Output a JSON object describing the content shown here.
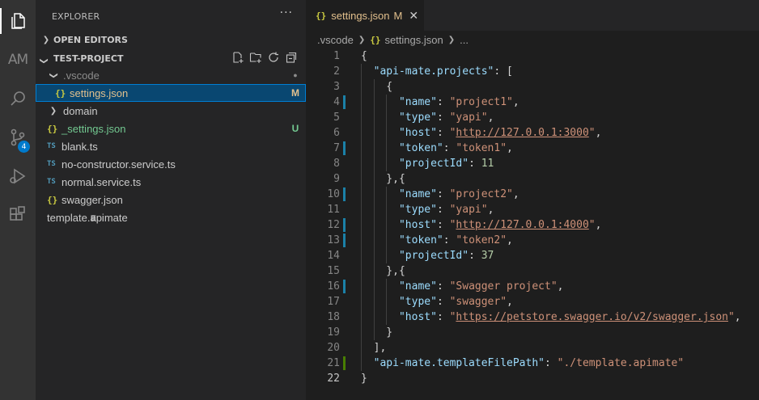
{
  "activity_bar": [
    {
      "name": "explorer-icon",
      "active": true
    },
    {
      "name": "api-mate-icon",
      "label": "AM"
    },
    {
      "name": "search-icon"
    },
    {
      "name": "source-control-icon",
      "badge": "4"
    },
    {
      "name": "run-debug-icon"
    },
    {
      "name": "extensions-icon"
    }
  ],
  "sidebar": {
    "title": "EXPLORER",
    "more": "···",
    "open_editors": "OPEN EDITORS",
    "project": "TEST-PROJECT",
    "tree": [
      {
        "label": ".vscode",
        "type": "folder",
        "expanded": true,
        "indent": 0,
        "color": "#8c8c8c",
        "deco": "●",
        "deco_color": "#8c8c8c"
      },
      {
        "label": "settings.json",
        "type": "json",
        "icon": "{}",
        "indent": 1,
        "color": "#e2c08d",
        "deco": "M",
        "deco_color": "#e2c08d",
        "selected": true
      },
      {
        "label": "domain",
        "type": "folder",
        "expanded": false,
        "indent": 0,
        "color": "#cccccc"
      },
      {
        "label": "_settings.json",
        "type": "json",
        "icon": "{}",
        "indent": 0,
        "color": "#73c991",
        "deco": "U",
        "deco_color": "#73c991"
      },
      {
        "label": "blank.ts",
        "type": "ts",
        "icon": "TS",
        "indent": 0,
        "color": "#cccccc"
      },
      {
        "label": "no-constructor.service.ts",
        "type": "ts",
        "icon": "TS",
        "indent": 0,
        "color": "#cccccc"
      },
      {
        "label": "normal.service.ts",
        "type": "ts",
        "icon": "TS",
        "indent": 0,
        "color": "#cccccc"
      },
      {
        "label": "swagger.json",
        "type": "json",
        "icon": "{}",
        "indent": 0,
        "color": "#cccccc"
      },
      {
        "label": "template.apimate",
        "type": "txt",
        "icon": "≡",
        "indent": 0,
        "color": "#cccccc"
      }
    ]
  },
  "editor": {
    "tab": {
      "icon": "{}",
      "label": "settings.json",
      "modified": "M",
      "close": "✕"
    },
    "breadcrumb": {
      "folder": ".vscode",
      "icon": "{}",
      "file": "settings.json",
      "tail": "..."
    },
    "lines": [
      {
        "n": "1",
        "gutter": "",
        "tokens": [
          [
            "{",
            "punc"
          ]
        ]
      },
      {
        "n": "2",
        "gutter": "",
        "tokens": [
          [
            "  ",
            "punc"
          ],
          [
            "\"api-mate.projects\"",
            "key"
          ],
          [
            ": [",
            "punc"
          ]
        ]
      },
      {
        "n": "3",
        "gutter": "",
        "tokens": [
          [
            "    {",
            "punc"
          ]
        ]
      },
      {
        "n": "4",
        "gutter": "mod",
        "tokens": [
          [
            "      ",
            "punc"
          ],
          [
            "\"name\"",
            "key"
          ],
          [
            ": ",
            "punc"
          ],
          [
            "\"project1\"",
            "str"
          ],
          [
            ",",
            "punc"
          ]
        ]
      },
      {
        "n": "5",
        "gutter": "",
        "tokens": [
          [
            "      ",
            "punc"
          ],
          [
            "\"type\"",
            "key"
          ],
          [
            ": ",
            "punc"
          ],
          [
            "\"yapi\"",
            "str"
          ],
          [
            ",",
            "punc"
          ]
        ]
      },
      {
        "n": "6",
        "gutter": "",
        "tokens": [
          [
            "      ",
            "punc"
          ],
          [
            "\"host\"",
            "key"
          ],
          [
            ": ",
            "punc"
          ],
          [
            "\"",
            "str"
          ],
          [
            "http://127.0.0.1:3000",
            "link"
          ],
          [
            "\"",
            "str"
          ],
          [
            ",",
            "punc"
          ]
        ]
      },
      {
        "n": "7",
        "gutter": "mod",
        "tokens": [
          [
            "      ",
            "punc"
          ],
          [
            "\"token\"",
            "key"
          ],
          [
            ": ",
            "punc"
          ],
          [
            "\"token1\"",
            "str"
          ],
          [
            ",",
            "punc"
          ]
        ]
      },
      {
        "n": "8",
        "gutter": "",
        "tokens": [
          [
            "      ",
            "punc"
          ],
          [
            "\"projectId\"",
            "key"
          ],
          [
            ": ",
            "punc"
          ],
          [
            "11",
            "num"
          ]
        ]
      },
      {
        "n": "9",
        "gutter": "",
        "tokens": [
          [
            "    },{",
            "punc"
          ]
        ]
      },
      {
        "n": "10",
        "gutter": "mod",
        "tokens": [
          [
            "      ",
            "punc"
          ],
          [
            "\"name\"",
            "key"
          ],
          [
            ": ",
            "punc"
          ],
          [
            "\"project2\"",
            "str"
          ],
          [
            ",",
            "punc"
          ]
        ]
      },
      {
        "n": "11",
        "gutter": "",
        "tokens": [
          [
            "      ",
            "punc"
          ],
          [
            "\"type\"",
            "key"
          ],
          [
            ": ",
            "punc"
          ],
          [
            "\"yapi\"",
            "str"
          ],
          [
            ",",
            "punc"
          ]
        ]
      },
      {
        "n": "12",
        "gutter": "mod",
        "tokens": [
          [
            "      ",
            "punc"
          ],
          [
            "\"host\"",
            "key"
          ],
          [
            ": ",
            "punc"
          ],
          [
            "\"",
            "str"
          ],
          [
            "http://127.0.0.1:4000",
            "link"
          ],
          [
            "\"",
            "str"
          ],
          [
            ",",
            "punc"
          ]
        ]
      },
      {
        "n": "13",
        "gutter": "mod",
        "tokens": [
          [
            "      ",
            "punc"
          ],
          [
            "\"token\"",
            "key"
          ],
          [
            ": ",
            "punc"
          ],
          [
            "\"token2\"",
            "str"
          ],
          [
            ",",
            "punc"
          ]
        ]
      },
      {
        "n": "14",
        "gutter": "",
        "tokens": [
          [
            "      ",
            "punc"
          ],
          [
            "\"projectId\"",
            "key"
          ],
          [
            ": ",
            "punc"
          ],
          [
            "37",
            "num"
          ]
        ]
      },
      {
        "n": "15",
        "gutter": "",
        "tokens": [
          [
            "    },{",
            "punc"
          ]
        ]
      },
      {
        "n": "16",
        "gutter": "mod",
        "tokens": [
          [
            "      ",
            "punc"
          ],
          [
            "\"name\"",
            "key"
          ],
          [
            ": ",
            "punc"
          ],
          [
            "\"Swagger project\"",
            "str"
          ],
          [
            ",",
            "punc"
          ]
        ]
      },
      {
        "n": "17",
        "gutter": "",
        "tokens": [
          [
            "      ",
            "punc"
          ],
          [
            "\"type\"",
            "key"
          ],
          [
            ": ",
            "punc"
          ],
          [
            "\"swagger\"",
            "str"
          ],
          [
            ",",
            "punc"
          ]
        ]
      },
      {
        "n": "18",
        "gutter": "",
        "tokens": [
          [
            "      ",
            "punc"
          ],
          [
            "\"host\"",
            "key"
          ],
          [
            ": ",
            "punc"
          ],
          [
            "\"",
            "str"
          ],
          [
            "https://petstore.swagger.io/v2/swagger.json",
            "link"
          ],
          [
            "\"",
            "str"
          ],
          [
            ",",
            "punc"
          ]
        ]
      },
      {
        "n": "19",
        "gutter": "",
        "tokens": [
          [
            "    }",
            "punc"
          ]
        ]
      },
      {
        "n": "20",
        "gutter": "",
        "tokens": [
          [
            "  ],",
            "punc"
          ]
        ]
      },
      {
        "n": "21",
        "gutter": "add",
        "tokens": [
          [
            "  ",
            "punc"
          ],
          [
            "\"api-mate.templateFilePath\"",
            "key"
          ],
          [
            ": ",
            "punc"
          ],
          [
            "\"./template.apimate\"",
            "str"
          ]
        ]
      },
      {
        "n": "22",
        "gutter": "",
        "current": true,
        "tokens": [
          [
            "}",
            "punc"
          ]
        ]
      }
    ]
  }
}
